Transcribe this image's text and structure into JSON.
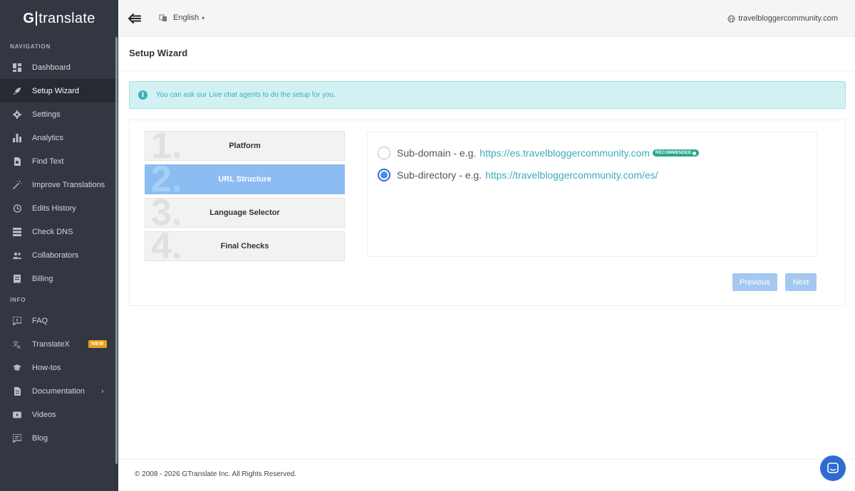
{
  "logo": {
    "g": "G",
    "text": "translate"
  },
  "sidebar": {
    "navigation_label": "NAVIGATION",
    "info_label": "INFO",
    "nav_items": [
      {
        "label": "Dashboard",
        "icon": "dashboard-icon"
      },
      {
        "label": "Setup Wizard",
        "icon": "rocket-icon",
        "active": true
      },
      {
        "label": "Settings",
        "icon": "gear-icon"
      },
      {
        "label": "Analytics",
        "icon": "bar-chart-icon"
      },
      {
        "label": "Find Text",
        "icon": "find-document-icon"
      },
      {
        "label": "Improve Translations",
        "icon": "magic-wand-icon"
      },
      {
        "label": "Edits History",
        "icon": "history-icon"
      },
      {
        "label": "Check DNS",
        "icon": "server-icon"
      },
      {
        "label": "Collaborators",
        "icon": "users-icon"
      },
      {
        "label": "Billing",
        "icon": "billing-icon"
      }
    ],
    "info_items": [
      {
        "label": "FAQ",
        "icon": "faq-icon"
      },
      {
        "label": "TranslateX",
        "icon": "translate-icon",
        "badge": "NEW"
      },
      {
        "label": "How-tos",
        "icon": "graduation-cap-icon"
      },
      {
        "label": "Documentation",
        "icon": "document-icon",
        "chevron": true
      },
      {
        "label": "Videos",
        "icon": "video-icon"
      },
      {
        "label": "Blog",
        "icon": "blog-icon"
      }
    ]
  },
  "topbar": {
    "language": "English",
    "site": "travelbloggercommunity.com"
  },
  "page": {
    "title": "Setup Wizard",
    "alert": "You can ask our Live chat agents to do the setup for you."
  },
  "wizard": {
    "steps": [
      {
        "num": "1.",
        "label": "Platform"
      },
      {
        "num": "2.",
        "label": "URL Structure",
        "active": true
      },
      {
        "num": "3.",
        "label": "Language Selector"
      },
      {
        "num": "4.",
        "label": "Final Checks"
      }
    ],
    "options": [
      {
        "text": "Sub-domain - e.g.",
        "link": "https://es.travelbloggercommunity.com",
        "badge": "RECOMMENDED",
        "checked": false
      },
      {
        "text": "Sub-directory - e.g.",
        "link": "https://travelbloggercommunity.com/es/",
        "checked": true
      }
    ],
    "previous_label": "Previous",
    "next_label": "Next"
  },
  "footer": {
    "text": "© 2008 - 2026 GTranslate Inc. All Rights Reserved."
  },
  "colors": {
    "sidebar_bg": "#323741",
    "active_step": "#8bbdf3",
    "link": "#3aaeb7",
    "chat_button": "#2f6bd1"
  }
}
